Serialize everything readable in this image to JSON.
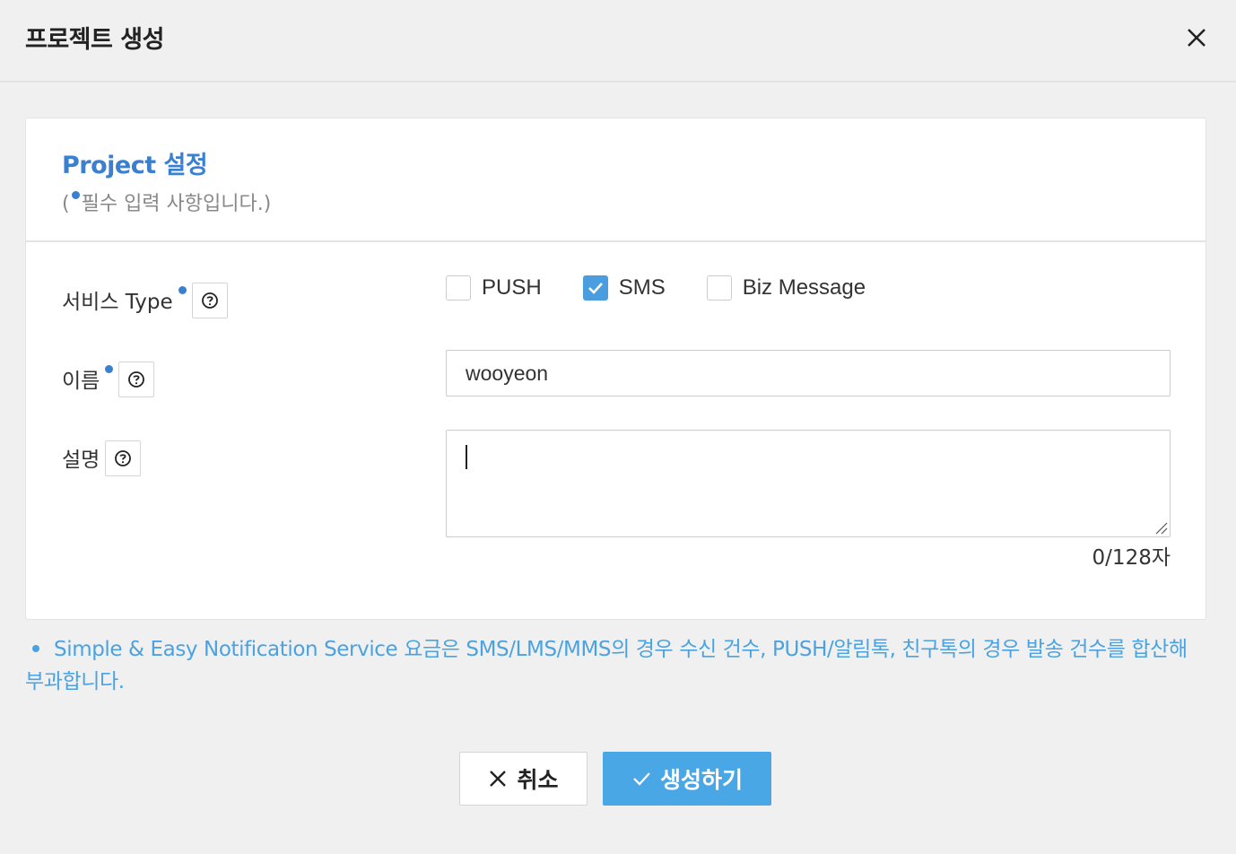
{
  "header": {
    "title": "프로젝트 생성",
    "close_icon": "close-icon"
  },
  "section": {
    "title": "Project 설정",
    "required_open": "(",
    "required_text": "필수 입력 사항입니다.)"
  },
  "fields": {
    "service_type": {
      "label": "서비스 Type",
      "options": [
        {
          "label": "PUSH",
          "checked": false
        },
        {
          "label": "SMS",
          "checked": true
        },
        {
          "label": "Biz Message",
          "checked": false
        }
      ]
    },
    "name": {
      "label": "이름",
      "value": "wooyeon"
    },
    "description": {
      "label": "설명",
      "value": "",
      "counter": "0/128자"
    }
  },
  "notice": "Simple & Easy Notification Service 요금은 SMS/LMS/MMS의 경우 수신 건수, PUSH/알림톡, 친구톡의 경우 발송 건수를 합산해 부과합니다.",
  "buttons": {
    "cancel": "취소",
    "create": "생성하기"
  },
  "colors": {
    "accent": "#3a7fd0",
    "primary_button": "#4aa7e6",
    "notice": "#4aa3e0"
  }
}
